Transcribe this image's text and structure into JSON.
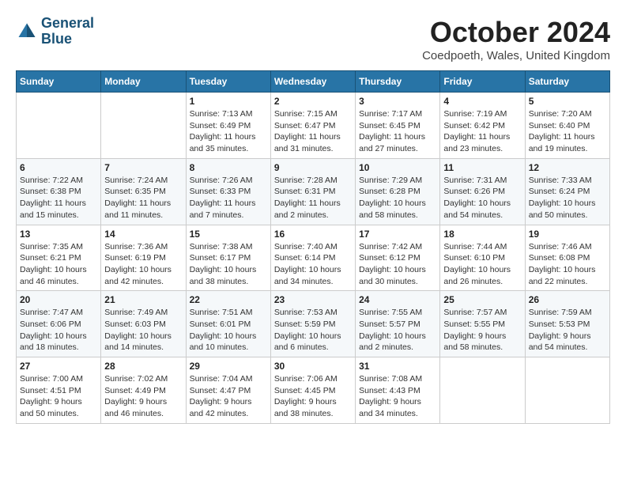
{
  "logo": {
    "line1": "General",
    "line2": "Blue"
  },
  "title": "October 2024",
  "location": "Coedpoeth, Wales, United Kingdom",
  "weekdays": [
    "Sunday",
    "Monday",
    "Tuesday",
    "Wednesday",
    "Thursday",
    "Friday",
    "Saturday"
  ],
  "weeks": [
    [
      {
        "day": "",
        "info": ""
      },
      {
        "day": "",
        "info": ""
      },
      {
        "day": "1",
        "info": "Sunrise: 7:13 AM\nSunset: 6:49 PM\nDaylight: 11 hours\nand 35 minutes."
      },
      {
        "day": "2",
        "info": "Sunrise: 7:15 AM\nSunset: 6:47 PM\nDaylight: 11 hours\nand 31 minutes."
      },
      {
        "day": "3",
        "info": "Sunrise: 7:17 AM\nSunset: 6:45 PM\nDaylight: 11 hours\nand 27 minutes."
      },
      {
        "day": "4",
        "info": "Sunrise: 7:19 AM\nSunset: 6:42 PM\nDaylight: 11 hours\nand 23 minutes."
      },
      {
        "day": "5",
        "info": "Sunrise: 7:20 AM\nSunset: 6:40 PM\nDaylight: 11 hours\nand 19 minutes."
      }
    ],
    [
      {
        "day": "6",
        "info": "Sunrise: 7:22 AM\nSunset: 6:38 PM\nDaylight: 11 hours\nand 15 minutes."
      },
      {
        "day": "7",
        "info": "Sunrise: 7:24 AM\nSunset: 6:35 PM\nDaylight: 11 hours\nand 11 minutes."
      },
      {
        "day": "8",
        "info": "Sunrise: 7:26 AM\nSunset: 6:33 PM\nDaylight: 11 hours\nand 7 minutes."
      },
      {
        "day": "9",
        "info": "Sunrise: 7:28 AM\nSunset: 6:31 PM\nDaylight: 11 hours\nand 2 minutes."
      },
      {
        "day": "10",
        "info": "Sunrise: 7:29 AM\nSunset: 6:28 PM\nDaylight: 10 hours\nand 58 minutes."
      },
      {
        "day": "11",
        "info": "Sunrise: 7:31 AM\nSunset: 6:26 PM\nDaylight: 10 hours\nand 54 minutes."
      },
      {
        "day": "12",
        "info": "Sunrise: 7:33 AM\nSunset: 6:24 PM\nDaylight: 10 hours\nand 50 minutes."
      }
    ],
    [
      {
        "day": "13",
        "info": "Sunrise: 7:35 AM\nSunset: 6:21 PM\nDaylight: 10 hours\nand 46 minutes."
      },
      {
        "day": "14",
        "info": "Sunrise: 7:36 AM\nSunset: 6:19 PM\nDaylight: 10 hours\nand 42 minutes."
      },
      {
        "day": "15",
        "info": "Sunrise: 7:38 AM\nSunset: 6:17 PM\nDaylight: 10 hours\nand 38 minutes."
      },
      {
        "day": "16",
        "info": "Sunrise: 7:40 AM\nSunset: 6:14 PM\nDaylight: 10 hours\nand 34 minutes."
      },
      {
        "day": "17",
        "info": "Sunrise: 7:42 AM\nSunset: 6:12 PM\nDaylight: 10 hours\nand 30 minutes."
      },
      {
        "day": "18",
        "info": "Sunrise: 7:44 AM\nSunset: 6:10 PM\nDaylight: 10 hours\nand 26 minutes."
      },
      {
        "day": "19",
        "info": "Sunrise: 7:46 AM\nSunset: 6:08 PM\nDaylight: 10 hours\nand 22 minutes."
      }
    ],
    [
      {
        "day": "20",
        "info": "Sunrise: 7:47 AM\nSunset: 6:06 PM\nDaylight: 10 hours\nand 18 minutes."
      },
      {
        "day": "21",
        "info": "Sunrise: 7:49 AM\nSunset: 6:03 PM\nDaylight: 10 hours\nand 14 minutes."
      },
      {
        "day": "22",
        "info": "Sunrise: 7:51 AM\nSunset: 6:01 PM\nDaylight: 10 hours\nand 10 minutes."
      },
      {
        "day": "23",
        "info": "Sunrise: 7:53 AM\nSunset: 5:59 PM\nDaylight: 10 hours\nand 6 minutes."
      },
      {
        "day": "24",
        "info": "Sunrise: 7:55 AM\nSunset: 5:57 PM\nDaylight: 10 hours\nand 2 minutes."
      },
      {
        "day": "25",
        "info": "Sunrise: 7:57 AM\nSunset: 5:55 PM\nDaylight: 9 hours\nand 58 minutes."
      },
      {
        "day": "26",
        "info": "Sunrise: 7:59 AM\nSunset: 5:53 PM\nDaylight: 9 hours\nand 54 minutes."
      }
    ],
    [
      {
        "day": "27",
        "info": "Sunrise: 7:00 AM\nSunset: 4:51 PM\nDaylight: 9 hours\nand 50 minutes."
      },
      {
        "day": "28",
        "info": "Sunrise: 7:02 AM\nSunset: 4:49 PM\nDaylight: 9 hours\nand 46 minutes."
      },
      {
        "day": "29",
        "info": "Sunrise: 7:04 AM\nSunset: 4:47 PM\nDaylight: 9 hours\nand 42 minutes."
      },
      {
        "day": "30",
        "info": "Sunrise: 7:06 AM\nSunset: 4:45 PM\nDaylight: 9 hours\nand 38 minutes."
      },
      {
        "day": "31",
        "info": "Sunrise: 7:08 AM\nSunset: 4:43 PM\nDaylight: 9 hours\nand 34 minutes."
      },
      {
        "day": "",
        "info": ""
      },
      {
        "day": "",
        "info": ""
      }
    ]
  ]
}
